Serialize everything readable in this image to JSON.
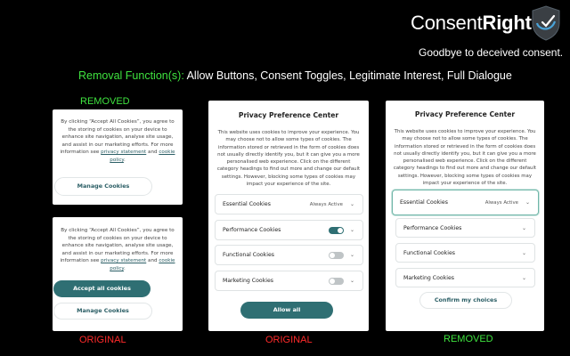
{
  "brand": {
    "name_light": "Consent",
    "name_bold": "Right",
    "tagline": "Goodbye to deceived consent.",
    "accent": "#3fe33f"
  },
  "removal": {
    "label": "Removal Function(s):",
    "values": "Allow Buttons, Consent Toggles, Legitimate Interest, Full Dialogue"
  },
  "labels": {
    "removed_top": "REMOVED",
    "original_left": "ORIGINAL",
    "original_mid": "ORIGINAL",
    "removed_right": "REMOVED"
  },
  "banner_removed": {
    "text": "By clicking “Accept All Cookies”, you agree to the storing of cookies on your device to enhance site navigation, analyse site usage, and assist in our marketing efforts. For more information see",
    "link1": "privacy statement",
    "and": "and",
    "link2": "cookie policy",
    "end": ".",
    "manage": "Manage Cookies"
  },
  "banner_original": {
    "text": "By clicking “Accept All Cookies”, you agree to the storing of cookies on your device to enhance site navigation, analyse site usage, and assist in our marketing efforts. For more information see",
    "link1": "privacy statement",
    "and": "and",
    "link2": "cookie policy",
    "end": ".",
    "accept": "Accept all cookies",
    "manage": "Manage Cookies"
  },
  "pref_original": {
    "title": "Privacy Preference Center",
    "desc": "This website uses cookies to improve your experience. You may choose not to allow some types of cookies. The information stored or retrieved in the form of cookies does not usually directly identify you, but it can give you a more personalised web experience. Click on the different category headings to find out more and change our default settings. However, blocking some types of cookies may impact your experience of the site.",
    "essential": "Essential Cookies",
    "always_active": "Always Active",
    "performance": "Performance Cookies",
    "functional": "Functional Cookies",
    "marketing": "Marketing Cookies",
    "allow": "Allow all"
  },
  "pref_removed": {
    "title": "Privacy Preference Center",
    "desc": "This website uses cookies to improve your experience. You may choose not to allow some types of cookies. The information stored or retrieved in the form of cookies does not usually directly identify you, but it can give you a more personalised web experience. Click on the different category headings to find out more and change our default settings. However, blocking some types of cookies may impact your experience of the site.",
    "essential": "Essential Cookies",
    "always_active": "Always Active",
    "performance": "Performance Cookies",
    "functional": "Functional Cookies",
    "marketing": "Marketing Cookies",
    "confirm": "Confirm my choices"
  }
}
